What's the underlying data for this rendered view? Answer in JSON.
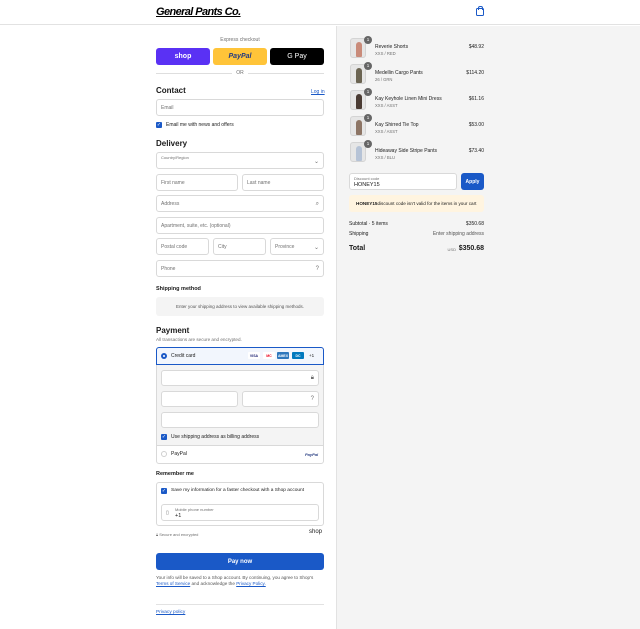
{
  "header": {
    "logo": "General Pants Co.",
    "cart_icon": "shopping-bag-icon"
  },
  "express": {
    "label": "Express checkout",
    "shop": "shop",
    "paypal": "PayPal",
    "gpay": "G Pay",
    "or": "OR"
  },
  "contact": {
    "title": "Contact",
    "login": "Log in",
    "email_placeholder": "Email",
    "news_label": "Email me with news and offers"
  },
  "delivery": {
    "title": "Delivery",
    "country_label": "Country/Region",
    "first_name": "First name",
    "last_name": "Last name",
    "address": "Address",
    "apartment": "Apartment, suite, etc. (optional)",
    "postal": "Postal code",
    "city": "City",
    "province": "Province",
    "phone": "Phone"
  },
  "shipping": {
    "title": "Shipping method",
    "message": "Enter your shipping address to view available shipping methods."
  },
  "payment": {
    "title": "Payment",
    "subtitle": "All transactions are secure and encrypted.",
    "credit_card": "Credit card",
    "cards": [
      "VISA",
      "MC",
      "AMEX",
      "DC"
    ],
    "more": "+1",
    "billing_label": "Use shipping address as billing address",
    "paypal": "PayPal",
    "paypal_logo": "PayPal"
  },
  "remember": {
    "title": "Remember me",
    "save_label": "Save my information for a faster checkout with a Shop account",
    "mobile_label": "Mobile phone number",
    "mobile_value": "+1",
    "secure": "Secure and encrypted",
    "shop_logo": "shop"
  },
  "pay_now": "Pay now",
  "fine_print": {
    "text": "Your info will be saved to a Shop account. By continuing, you agree to Shop's",
    "terms": "Terms of Service",
    "mid": "and acknowledge the",
    "privacy": "Privacy Policy."
  },
  "privacy_policy": "Privacy policy",
  "order": {
    "items": [
      {
        "qty": "1",
        "name": "Reverie Shorts",
        "variant": "XXS / RED",
        "price": "$48.92"
      },
      {
        "qty": "1",
        "name": "Medellin Cargo Pants",
        "variant": "26 / GRN",
        "price": "$114.20"
      },
      {
        "qty": "1",
        "name": "Kay Keyhole Linen Mini Dress",
        "variant": "XXS / ASST",
        "price": "$61.16"
      },
      {
        "qty": "1",
        "name": "Kay Shirred Tie Top",
        "variant": "XXS / ASST",
        "price": "$53.00"
      },
      {
        "qty": "1",
        "name": "Hideaway Side Stripe Pants",
        "variant": "XXS / BLU",
        "price": "$73.40"
      }
    ],
    "discount_label": "Discount code",
    "discount_value": "HONEY15",
    "apply": "Apply",
    "warning_code": "HONEY15",
    "warning_text": " discount code isn't valid for the items in your cart",
    "subtotal_label": "Subtotal · 5 items",
    "subtotal_value": "$350.68",
    "shipping_label": "Shipping",
    "shipping_value": "Enter shipping address",
    "total_label": "Total",
    "currency": "USD",
    "total_value": "$350.68"
  }
}
